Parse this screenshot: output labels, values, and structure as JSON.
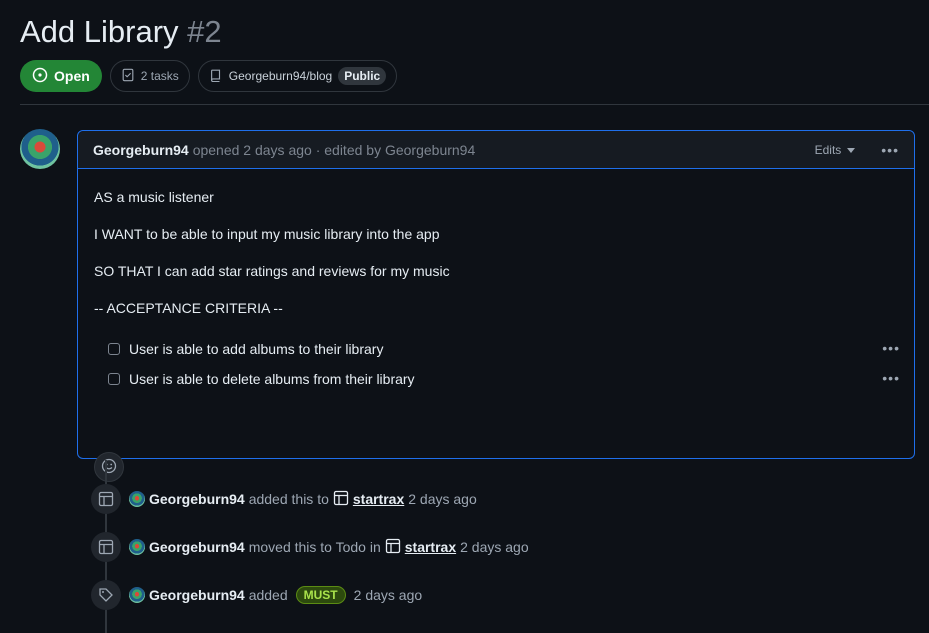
{
  "issue": {
    "title": "Add Library",
    "number": "#2",
    "state": "Open",
    "tasks": "2 tasks",
    "repo": "Georgeburn94/blog",
    "visibility": "Public"
  },
  "comment": {
    "author": "Georgeburn94",
    "meta": "opened 2 days ago · edited by Georgeburn94",
    "edits_label": "Edits",
    "lines": [
      "AS a music listener",
      "I WANT to be able to input my music library into the app",
      "SO THAT I can add star ratings and reviews for my music",
      "-- ACCEPTANCE CRITERIA --"
    ],
    "tasks": [
      "User is able to add albums to their library",
      "User is able to delete albums from their library"
    ]
  },
  "timeline": [
    {
      "author": "Georgeburn94",
      "action": "added this to",
      "project": "startrax",
      "time": "2 days ago"
    },
    {
      "author": "Georgeburn94",
      "action": "moved this to Todo in",
      "project": "startrax",
      "time": "2 days ago"
    },
    {
      "author": "Georgeburn94",
      "action": "added",
      "label": "MUST",
      "time": "2 days ago"
    }
  ],
  "colors": {
    "background": "#0d1117",
    "open": "#238636",
    "focus_border": "#1f6feb",
    "label_must": "#a9e24b"
  },
  "icons": {
    "state": "issue-opened-icon",
    "tasks": "checklist-icon",
    "repo": "repo-icon",
    "reaction": "smiley-icon",
    "project": "table-icon",
    "label": "tag-icon"
  }
}
